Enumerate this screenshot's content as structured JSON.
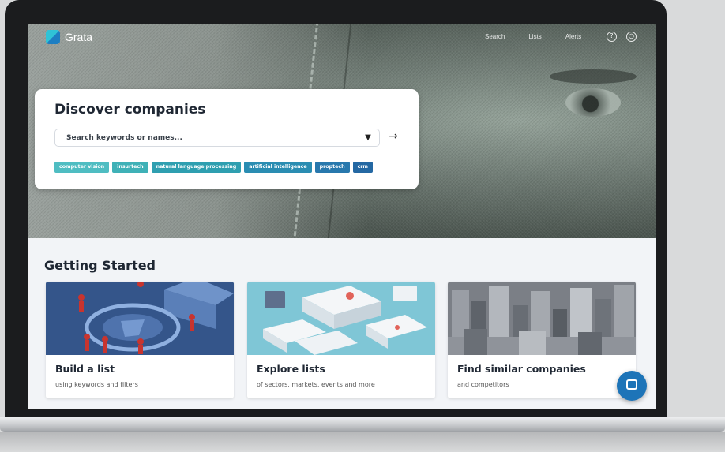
{
  "nav": {
    "logo": "Grata",
    "links": [
      "Search",
      "Lists",
      "Alerts"
    ]
  },
  "search": {
    "title": "Discover companies",
    "placeholder": "Search keywords or names...",
    "tags": [
      {
        "label": "computer vision",
        "color": "#4fbdc2"
      },
      {
        "label": "insurtech",
        "color": "#3fb1b7"
      },
      {
        "label": "natural language processing",
        "color": "#2f9fb0"
      },
      {
        "label": "artificial intelligence",
        "color": "#2a8db2"
      },
      {
        "label": "proptech",
        "color": "#2878ad"
      },
      {
        "label": "crm",
        "color": "#2468a3"
      }
    ]
  },
  "getting_started": {
    "title": "Getting Started",
    "cards": [
      {
        "title": "Build a list",
        "subtitle": "using keywords and filters"
      },
      {
        "title": "Explore lists",
        "subtitle": "of sectors, markets, events and more"
      },
      {
        "title": "Find similar companies",
        "subtitle": "and competitors"
      }
    ]
  },
  "icons": {
    "filter": "filter-icon",
    "submit": "arrow-right-icon",
    "help": "help-icon",
    "account": "account-icon",
    "chat": "chat-icon"
  },
  "colors": {
    "brand_teal": "#2fc3d6",
    "brand_blue": "#1d74b8",
    "bezel": "#1b1c1e"
  }
}
